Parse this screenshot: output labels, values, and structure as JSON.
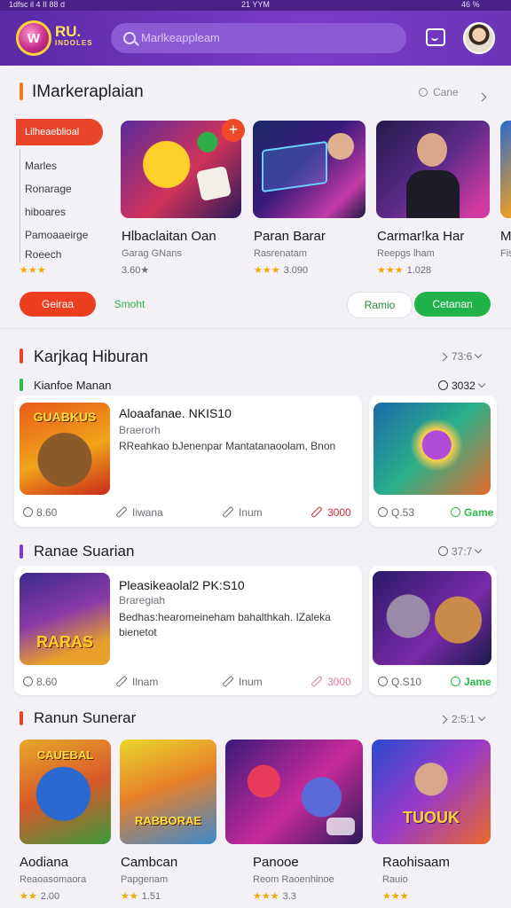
{
  "status": {
    "left": "1dfsc il 4 II 88 d",
    "time": "21 YYM",
    "right": "46 %"
  },
  "header": {
    "logo": "W",
    "brand": "RU.",
    "brand_sub": "INDOLES",
    "search_placeholder": "Marlkeappleam"
  },
  "section1": {
    "title": "IMarkeraplaian",
    "search_label": "Cane",
    "side": {
      "header": "Lilheaeblioal",
      "items": [
        "Marles",
        "Ronarage",
        "hiboares",
        "Pamoaaeirge",
        "Roeech"
      ]
    },
    "items": [
      {
        "name": "Hlbaclaitan Oan",
        "sub": "Garag GNans",
        "stars": "★★★",
        "rating": "3.60★"
      },
      {
        "name": "Paran Barar",
        "sub": "Rasrenatam",
        "stars": "★★★",
        "rating": "3.090"
      },
      {
        "name": "Carmar!ka Har",
        "sub": "Reepgs lham",
        "stars": "★★★",
        "rating": "1.028"
      },
      {
        "name": "M",
        "sub": "Fis",
        "stars": "★",
        "rating": ""
      }
    ],
    "pills": [
      "Geiraa",
      "Smoht",
      "Ramio",
      "Cetanan"
    ]
  },
  "section2": {
    "title": "Karjkaq Hiburan",
    "right": "73:6",
    "subheader": "Kianfoe Manan",
    "subright": "3032",
    "item": {
      "title": "Aloaafanae. NKIS10",
      "sub": "Braerorh",
      "desc": "RReahkao bJenenpar Mantatanaoolam, Bnon",
      "thumb_text": "GUABKUS"
    },
    "actions": [
      "8.60",
      "Iiwana",
      "Inum",
      "3000"
    ],
    "side_actions": [
      "Q.53",
      "Game"
    ]
  },
  "section3": {
    "title": "Ranae Suarian",
    "right": "37:7",
    "item": {
      "title": "Pleasikeaolal2 PK:S10",
      "sub": "Braregiah",
      "desc": "Bedhas:hearomeineham bahalthkah. IZaleka bienetot",
      "thumb_text": "RARAS"
    },
    "actions": [
      "8.60",
      "Ilnam",
      "Inum",
      "3000"
    ],
    "side_actions": [
      "Q.S10",
      "Jame"
    ]
  },
  "section4": {
    "title": "Ranun Sunerar",
    "right": "2:5:1",
    "items": [
      {
        "name": "Aodiana",
        "sub": "Reaoasomaora",
        "stars": "★★",
        "rating": "2.00",
        "thumb_text": "CAUEBAL"
      },
      {
        "name": "Cambcan",
        "sub": "Papgenam",
        "stars": "★★",
        "rating": "1.51",
        "thumb_text": "RABBORAE"
      },
      {
        "name": "Panooe",
        "sub": "Reom Raoenhinoe",
        "stars": "★★★",
        "rating": "3.3",
        "thumb_text": ""
      },
      {
        "name": "Raohisaam",
        "sub": "Rauio",
        "stars": "★★★",
        "rating": "",
        "thumb_text": "TUOUK"
      }
    ]
  },
  "colors": {
    "brand": "#6b35b8",
    "accent_red": "#e8452a",
    "accent_green": "#2db84b"
  }
}
